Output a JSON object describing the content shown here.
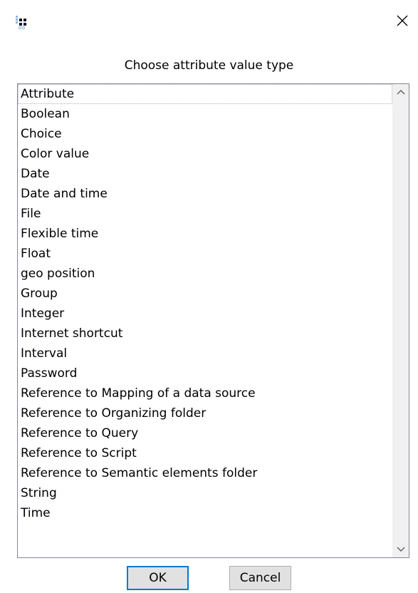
{
  "dialog": {
    "prompt": "Choose attribute value type",
    "items": [
      "Attribute",
      "Boolean",
      "Choice",
      "Color value",
      "Date",
      "Date and time",
      "File",
      "Flexible time",
      "Float",
      "geo position",
      "Group",
      "Integer",
      "Internet shortcut",
      "Interval",
      "Password",
      "Reference to Mapping of a data source",
      "Reference to Organizing folder",
      "Reference to Query",
      "Reference to Script",
      "Reference to Semantic elements folder",
      "String",
      "Time"
    ],
    "focused_item": "Attribute",
    "ok_label": "OK",
    "cancel_label": "Cancel"
  },
  "icons": {
    "app": "app-grid-icon",
    "close": "close-icon",
    "scroll_up": "chevron-up-icon",
    "scroll_down": "chevron-down-icon"
  },
  "colors": {
    "accent": "#0078d7",
    "list_border": "#828790",
    "button_face": "#e1e1e1",
    "app_icon_dark": "#1a1a2e",
    "app_icon_light": "#8fb6e0"
  }
}
